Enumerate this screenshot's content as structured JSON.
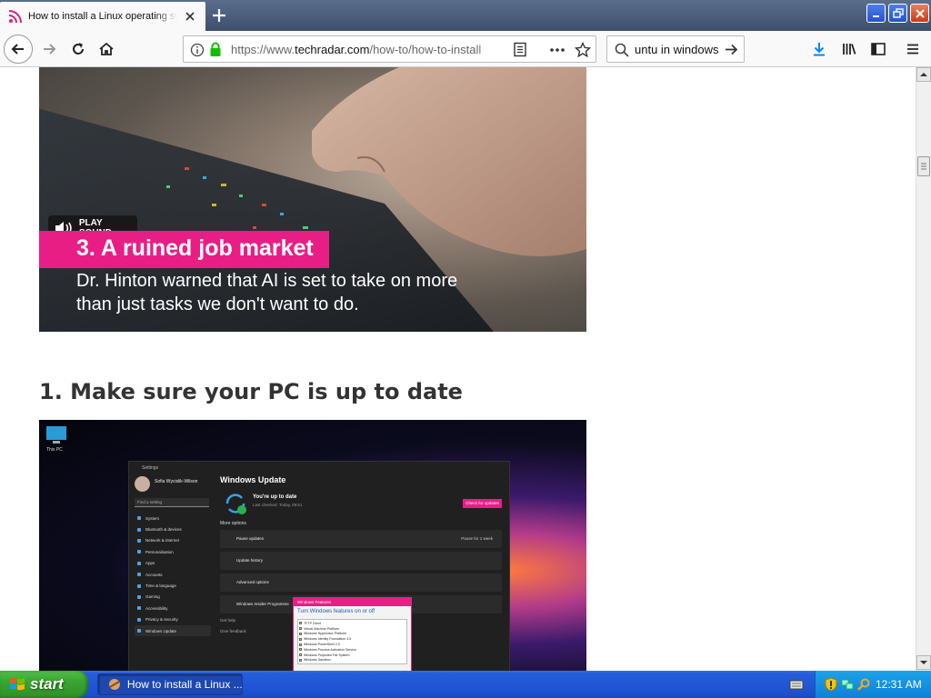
{
  "browser": {
    "tab": {
      "title": "How to install a Linux operating system"
    },
    "url": {
      "prefix": "https://www.",
      "domain": "techradar.com",
      "path": "/how-to/how-to-install"
    },
    "search": {
      "value": "untu in windows"
    }
  },
  "article": {
    "video": {
      "play_sound_label": "PLAY SOUND",
      "caption_title": "3. A ruined job market",
      "caption_subtitle": "Dr. Hinton warned that AI is set to take on more than just tasks we don't want to do."
    },
    "section_heading": "1. Make sure your PC is up to date",
    "screenshot": {
      "desktop_icon_label": "This PC",
      "settings_title": "Settings",
      "user_name": "Sofia Wycislik-Wilson",
      "search_placeholder": "Find a setting",
      "page_title": "Windows Update",
      "status_title": "You're up to date",
      "status_sub": "Last checked: Today, 09:51",
      "check_button": "Check for updates",
      "more_options": "More options",
      "sidebar": [
        "System",
        "Bluetooth & devices",
        "Network & internet",
        "Personalisation",
        "Apps",
        "Accounts",
        "Time & language",
        "Gaming",
        "Accessibility",
        "Privacy & security",
        "Windows Update"
      ],
      "options": [
        {
          "label": "Pause updates",
          "value": "Pause for 1 week"
        },
        {
          "label": "Update history",
          "value": ""
        },
        {
          "label": "Advanced options",
          "value": ""
        },
        {
          "label": "Windows Insider Programme",
          "value": ""
        }
      ],
      "help_links": [
        "Get help",
        "Give feedback"
      ],
      "features_dialog": {
        "title": "Windows Features",
        "heading": "Turn Windows features on or off",
        "items": [
          "TFTP Client",
          "Virtual Machine Platform",
          "Windows Hypervisor Platform",
          "Windows Identity Foundation 3.5",
          "Windows PowerShell 2.0",
          "Windows Process Activation Service",
          "Windows Projected File System",
          "Windows Sandbox"
        ]
      }
    }
  },
  "taskbar": {
    "start_label": "start",
    "task_label": "How to install a Linux ...",
    "clock": "12:31 AM"
  },
  "colors": {
    "accent_pink": "#e91e85",
    "xp_blue": "#245edb",
    "xp_green": "#3aa531"
  }
}
